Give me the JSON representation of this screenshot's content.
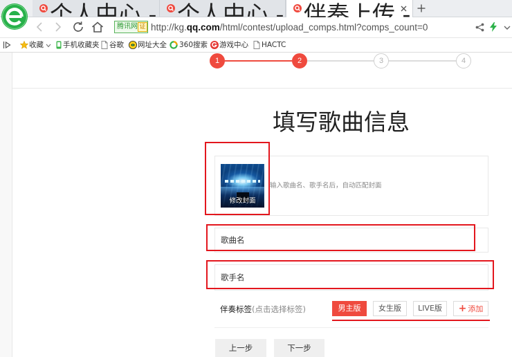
{
  "browser": {
    "tabs": [
      {
        "title": "个人中心 - 全民K歌",
        "state": "inactive"
      },
      {
        "title": "个人中心 - 全民K歌",
        "state": "inactive"
      },
      {
        "title": "伴奏上传 - 全民K歌",
        "state": "active"
      }
    ],
    "security_badge": {
      "name": "腾讯网",
      "mark": "证"
    },
    "url": {
      "prefix": "http://kg.",
      "domain": "qq.com",
      "path": "/html/contest/upload_comps.html?comps_count=0"
    },
    "bookmarks": [
      {
        "label": "收藏",
        "icon": "star-icon"
      },
      {
        "label": "手机收藏夹",
        "icon": "phone-icon"
      },
      {
        "label": "谷歌",
        "icon": "page-icon"
      },
      {
        "label": "网址大全",
        "icon": "web-nav-icon"
      },
      {
        "label": "360搜索",
        "icon": "search-360-icon"
      },
      {
        "label": "游戏中心",
        "icon": "game-center-icon"
      },
      {
        "label": "HACTC",
        "icon": "page-icon"
      }
    ]
  },
  "steps": [
    {
      "number": "1",
      "state": "done"
    },
    {
      "number": "2",
      "state": "current"
    },
    {
      "number": "3",
      "state": "pending"
    },
    {
      "number": "4",
      "state": "pending"
    }
  ],
  "page": {
    "title": "填写歌曲信息",
    "cover": {
      "button_label": "修改封面",
      "hint": "输入歌曲名、歌手名后，自动匹配封面"
    },
    "song_field": {
      "placeholder": "歌曲名"
    },
    "singer_field": {
      "placeholder": "歌手名"
    },
    "tags": {
      "label": "伴奏标签",
      "hint": "(点击选择标签)",
      "options": [
        {
          "label": "男主版",
          "state": "selected"
        },
        {
          "label": "女生版",
          "state": "normal"
        },
        {
          "label": "LIVE版",
          "state": "normal"
        }
      ],
      "add_glyph": "+",
      "add_label": "添加"
    },
    "prev_button": "上一步",
    "next_button": "下一步"
  },
  "colors": {
    "accent": "#ef4a3e",
    "annotation": "#e3161d",
    "browser_green": "#27b14a"
  }
}
